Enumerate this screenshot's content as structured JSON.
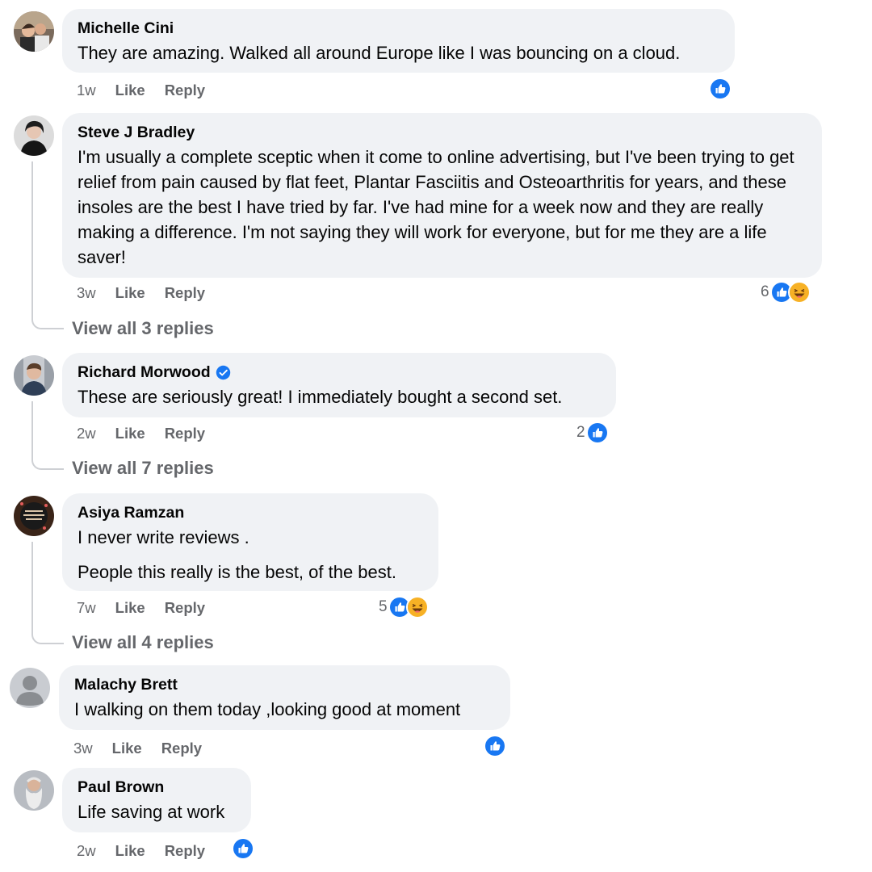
{
  "comments": [
    {
      "author": "Michelle Cini",
      "text": [
        "They are amazing. Walked all around Europe like I was bouncing on a cloud."
      ],
      "time": "1w",
      "like_label": "Like",
      "reply_label": "Reply",
      "reaction_count": "",
      "reactions": [
        "like"
      ]
    },
    {
      "author": "Steve J Bradley",
      "text": [
        "I'm usually a complete sceptic when it come to online advertising, but I've been trying to get relief from pain caused by flat feet, Plantar Fasciitis and Osteoarthritis for years, and these insoles are the best I have tried by far. I've had mine for a week now and they are really making a difference. I'm not saying they will work for everyone, but for me they are a life saver!"
      ],
      "time": "3w",
      "like_label": "Like",
      "reply_label": "Reply",
      "reaction_count": "6",
      "reactions": [
        "like",
        "haha"
      ],
      "view_replies": "View all 3 replies"
    },
    {
      "author": "Richard Morwood",
      "verified": true,
      "text": [
        "These are seriously great! I immediately bought a second set."
      ],
      "time": "2w",
      "like_label": "Like",
      "reply_label": "Reply",
      "reaction_count": "2",
      "reactions": [
        "like"
      ],
      "view_replies": "View all 7 replies"
    },
    {
      "author": "Asiya Ramzan",
      "text": [
        "I never write reviews .",
        "People this really is the best, of the best."
      ],
      "time": "7w",
      "like_label": "Like",
      "reply_label": "Reply",
      "reaction_count": "5",
      "reactions": [
        "like",
        "haha"
      ],
      "view_replies": "View all 4 replies"
    },
    {
      "author": "Malachy Brett",
      "text": [
        "I walking on them today ,looking good at moment"
      ],
      "time": "3w",
      "like_label": "Like",
      "reply_label": "Reply",
      "reaction_count": "",
      "reactions": [
        "like"
      ]
    },
    {
      "author": "Paul Brown",
      "text": [
        "Life saving at work"
      ],
      "time": "2w",
      "like_label": "Like",
      "reply_label": "Reply",
      "reaction_count": "",
      "reactions": [
        "like"
      ]
    }
  ],
  "colors": {
    "bubble": "#f0f2f5",
    "meta_text": "#65676b",
    "like_blue": "#1877f2",
    "haha_yellow": "#f7b125",
    "thread_line": "#ced0d4"
  },
  "icons": {
    "like": "thumbs-up-icon",
    "haha": "laughing-face-icon",
    "verified": "verified-badge-icon",
    "default_avatar": "person-silhouette-icon"
  }
}
